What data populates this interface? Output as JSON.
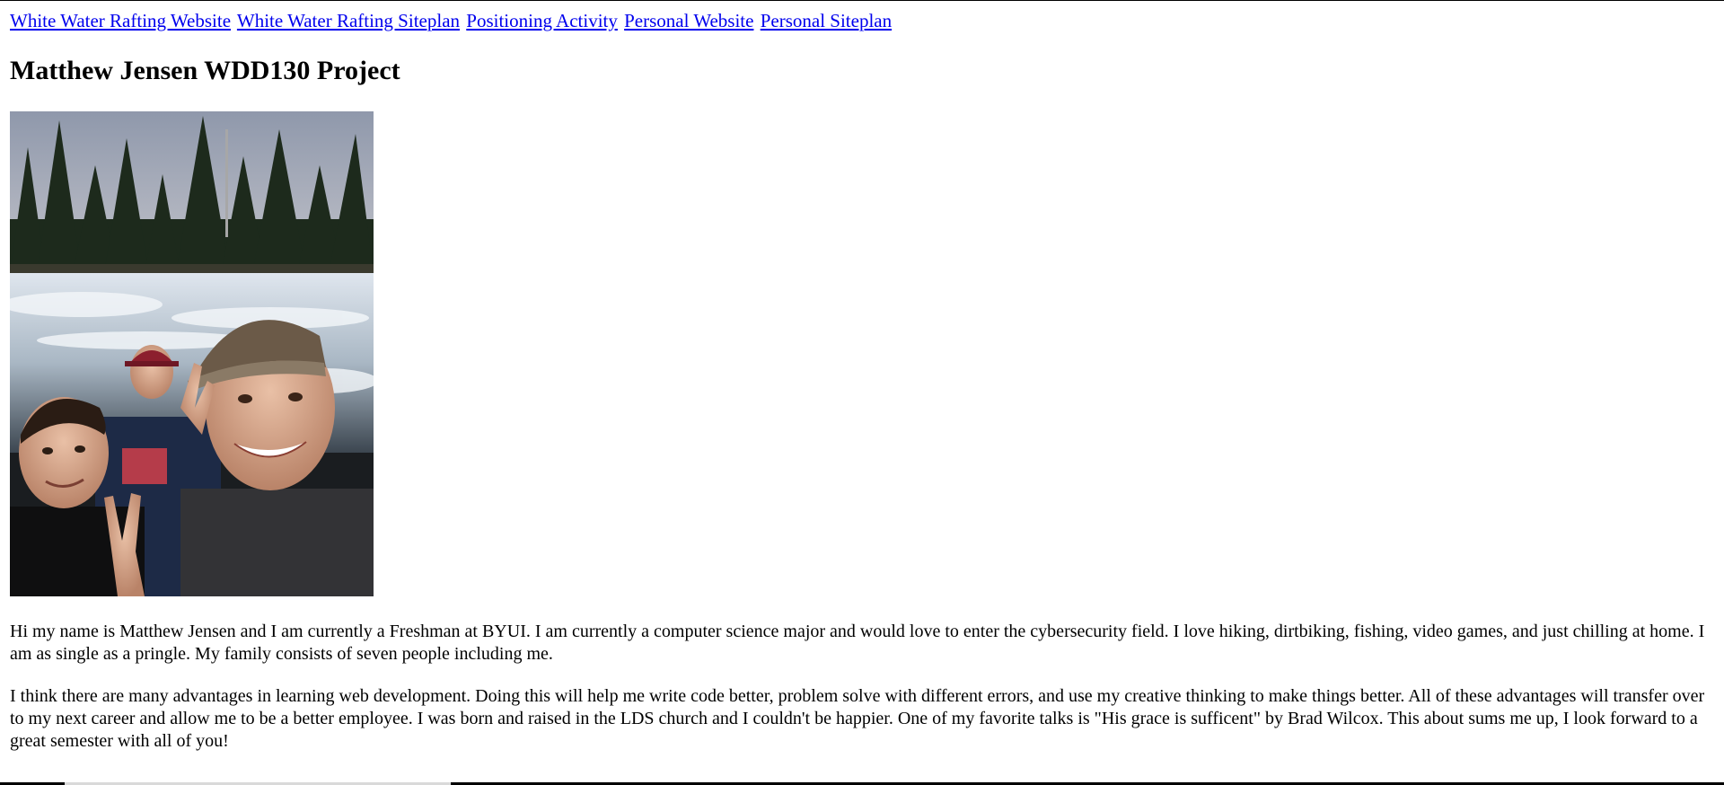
{
  "nav": {
    "links": [
      "White Water Rafting Website",
      "White Water Rafting Siteplan",
      "Positioning Activity",
      "Personal Website",
      "Personal Siteplan"
    ]
  },
  "header": {
    "title": "Matthew Jensen WDD130 Project"
  },
  "main": {
    "paragraphs": [
      "Hi my name is Matthew Jensen and I am currently a Freshman at BYUI. I am currently a computer science major and would love to enter the cybersecurity field. I love hiking, dirtbiking, fishing, video games, and just chilling at home. I am as single as a pringle. My family consists of seven people including me.",
      "I think there are many advantages in learning web development. Doing this will help me write code better, problem solve with different errors, and use my creative thinking to make things better. All of these advantages will transfer over to my next career and allow me to be a better employee. I was born and raised in the LDS church and I couldn't be happier. One of my favorite talks is \"His grace is sufficent\" by Brad Wilcox. This about sums me up, I look forward to a great semester with all of you!"
    ]
  },
  "colors": {
    "link": "#0000ee",
    "text": "#000000",
    "background": "#ffffff"
  }
}
